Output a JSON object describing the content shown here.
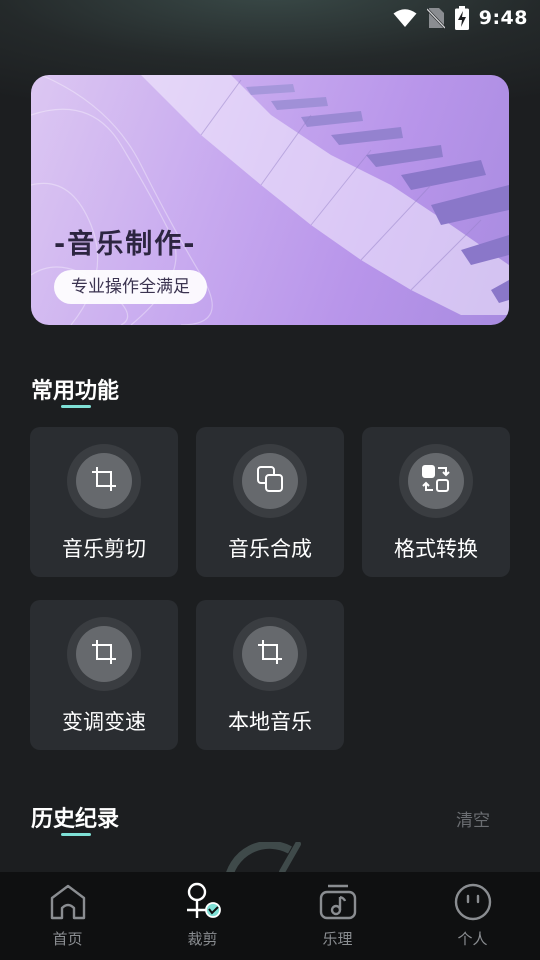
{
  "status_bar": {
    "time": "9:48"
  },
  "banner": {
    "title": "-音乐制作-",
    "subtitle": "专业操作全满足"
  },
  "common_functions": {
    "title": "常用功能",
    "items": [
      {
        "label": "音乐剪切",
        "icon": "crop-icon"
      },
      {
        "label": "音乐合成",
        "icon": "merge-icon"
      },
      {
        "label": "格式转换",
        "icon": "convert-icon"
      },
      {
        "label": "变调变速",
        "icon": "crop-icon"
      },
      {
        "label": "本地音乐",
        "icon": "crop-icon"
      }
    ]
  },
  "history": {
    "title": "历史纪录",
    "clear_label": "清空"
  },
  "bottom_nav": {
    "items": [
      {
        "label": "首页",
        "icon": "home-icon"
      },
      {
        "label": "裁剪",
        "icon": "clip-icon",
        "active": true
      },
      {
        "label": "乐理",
        "icon": "music-note-icon"
      },
      {
        "label": "个人",
        "icon": "profile-face-icon"
      }
    ]
  },
  "colors": {
    "accent": "#7fe0d6",
    "background": "#1c1e20",
    "card": "#2a2d31"
  }
}
